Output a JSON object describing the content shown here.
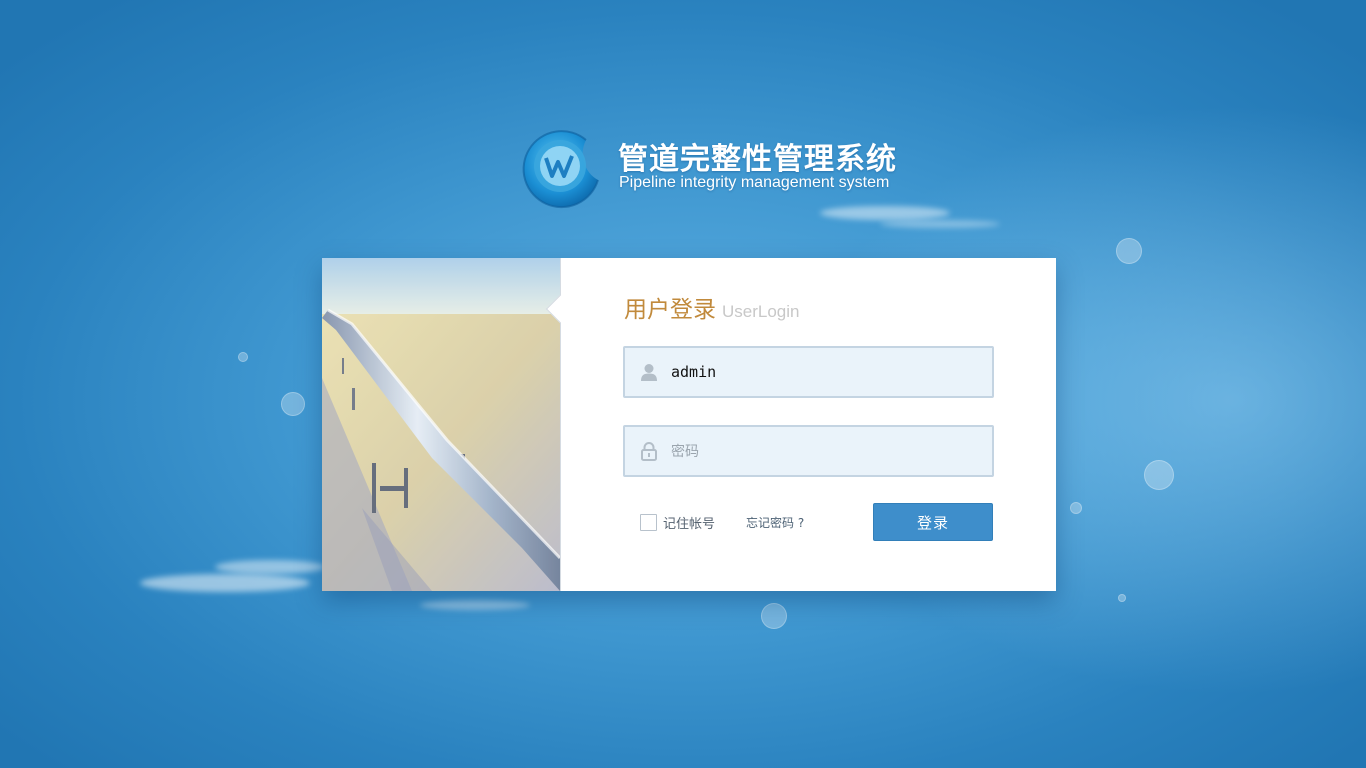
{
  "brand": {
    "title_cn": "管道完整性管理系统",
    "title_en": "Pipeline integrity management system",
    "logo_letter": "W"
  },
  "login": {
    "title_cn": "用户登录",
    "title_en": "UserLogin",
    "username": {
      "value": "admin",
      "placeholder": ""
    },
    "password": {
      "value": "",
      "placeholder": "密码"
    },
    "remember_label": "记住帐号",
    "remember_checked": false,
    "forgot_label": "忘记密码 ?",
    "submit_label": "登录"
  },
  "icons": {
    "username": "user-icon",
    "password": "lock-icon"
  },
  "colors": {
    "background": "#3f97d0",
    "title_accent": "#c18a3c",
    "button": "#3e8ecb",
    "field_bg": "#eaf3fa"
  }
}
